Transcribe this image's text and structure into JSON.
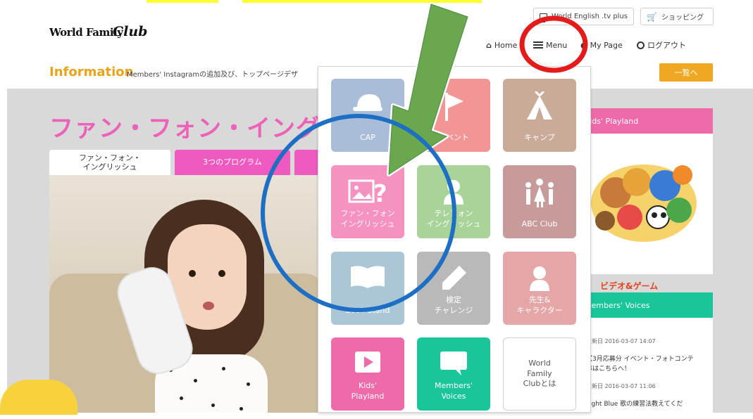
{
  "header": {
    "logo_part1": "World Family",
    "logo_part2": "Club",
    "tv_plus_label": "World English .tv plus",
    "shopping_label": "ショッピング",
    "nav": {
      "home": "Home",
      "menu": "Menu",
      "mypage": "My Page",
      "logout": "ログアウト"
    }
  },
  "info_bar": {
    "title": "Information",
    "text": "Members' Instagramの追加及び、トップページデザ",
    "list_button": "一覧へ"
  },
  "main": {
    "title": "ファン・フォン・イングリ",
    "tabs": [
      {
        "label": "ファン・フォン・\nイングリッシュ"
      },
      {
        "label": "3つのプログラム"
      }
    ]
  },
  "menu": {
    "items": [
      {
        "label": "CAP",
        "color": "#a9bcd8",
        "icon": "cap-icon"
      },
      {
        "label": "イベント",
        "color": "#f49595",
        "icon": "flag-icon"
      },
      {
        "label": "キャンプ",
        "color": "#c9ab98",
        "icon": "tent-icon"
      },
      {
        "label": "ファン・フォン\nイングリッシュ",
        "color": "#f592c0",
        "icon": "picture-question-icon"
      },
      {
        "label": "テレフォン\nイングリッシュ",
        "color": "#a8d49a",
        "icon": "person-icon"
      },
      {
        "label": "ABC Club",
        "color": "#c89a9a",
        "icon": "family-icon"
      },
      {
        "label": "Book Stand",
        "color": "#abc6d6",
        "icon": "book-icon"
      },
      {
        "label": "検定\nチャレンジ",
        "color": "#b9b9b9",
        "icon": "pencil-icon"
      },
      {
        "label": "先生&\nキャラクター",
        "color": "#e4a6a6",
        "icon": "teacher-icon"
      },
      {
        "label": "Kids'\nPlayland",
        "color": "#ee6aa8",
        "icon": "play-icon"
      },
      {
        "label": "Members'\nVoices",
        "color": "#18c69a",
        "icon": "speech-bubble-icon"
      },
      {
        "label": "World\nFamily\nClubとは",
        "color": "#ffffff",
        "icon": ""
      }
    ]
  },
  "sidebar": {
    "kids_header": "Kids' Playland",
    "video_label": "ビデオ&ゲーム",
    "voices_header": "Members' Voices",
    "voices": [
      {
        "date": "更新日  2016-03-07 14:07",
        "text": "【3月応募分 イベント・フォトコンテ\n募はこちらへ！"
      },
      {
        "date": "更新日  2016-03-07 11:06",
        "text": "Light Blue 歌の練習法教えてくだ"
      }
    ]
  },
  "annotations": {
    "red_circle_color": "#e31b1b",
    "blue_circle_color": "#1d6fc4",
    "arrow_color": "#6aa84f"
  }
}
